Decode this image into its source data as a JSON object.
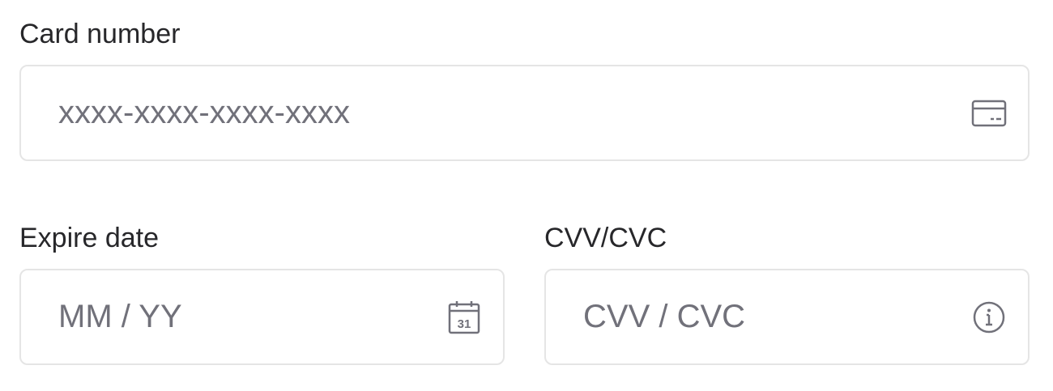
{
  "card_number": {
    "label": "Card number",
    "value": "",
    "placeholder": "xxxx-xxxx-xxxx-xxxx",
    "icon": "credit-card-icon"
  },
  "expire_date": {
    "label": "Expire date",
    "value": "",
    "placeholder": "MM / YY",
    "icon": "calendar-icon",
    "icon_text": "31"
  },
  "cvv": {
    "label": "CVV/CVC",
    "value": "",
    "placeholder": "CVV / CVC",
    "icon": "info-icon"
  },
  "colors": {
    "label_text": "#27272a",
    "placeholder_text": "#71717a",
    "border": "#e5e5e5",
    "icon": "#71717a",
    "background": "#ffffff"
  }
}
